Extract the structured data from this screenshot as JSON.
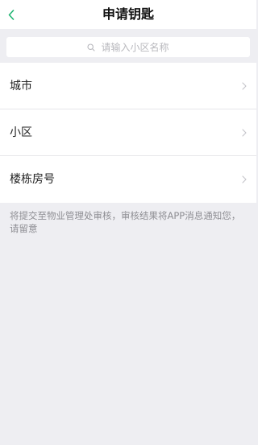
{
  "header": {
    "title": "申请钥匙",
    "back_icon": "chevron-left-icon",
    "accent_color": "#21b573"
  },
  "search": {
    "icon": "search-icon",
    "placeholder": "请输入小区名称"
  },
  "list": {
    "items": [
      {
        "label": "城市",
        "icon": "chevron-right-icon"
      },
      {
        "label": "小区",
        "icon": "chevron-right-icon"
      },
      {
        "label": "楼栋房号",
        "icon": "chevron-right-icon"
      }
    ]
  },
  "note": {
    "text": "将提交至物业管理处审核，审核结果将APP消息通知您，请留意"
  }
}
